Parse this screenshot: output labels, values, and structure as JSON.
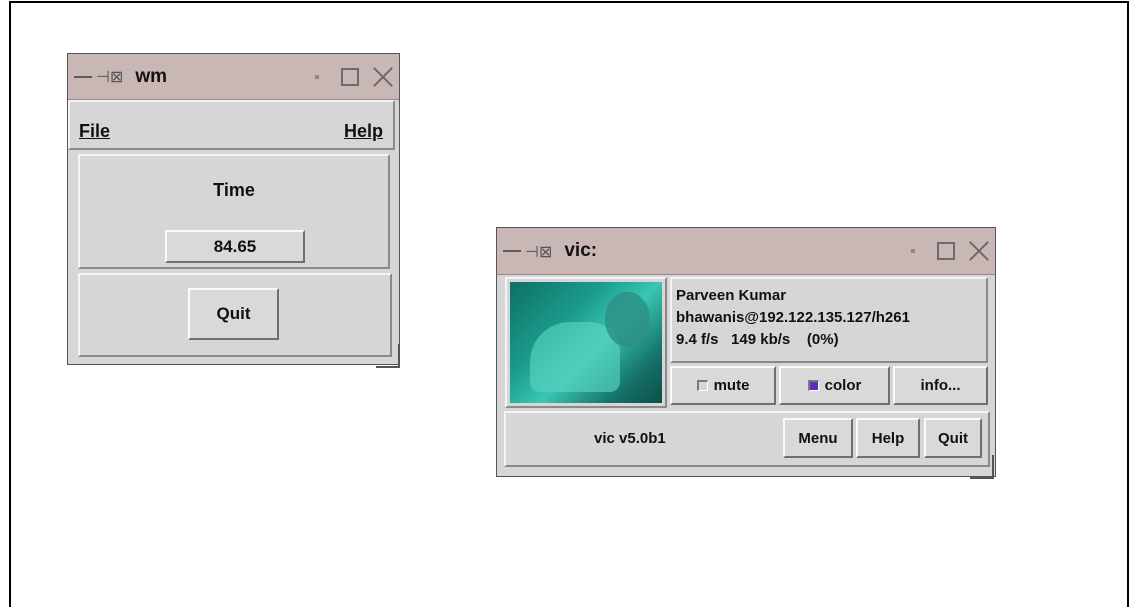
{
  "wm_window": {
    "title": "wm",
    "menu": {
      "file": "File",
      "help": "Help"
    },
    "time_label": "Time",
    "time_value": "84.65",
    "quit_label": "Quit"
  },
  "vic_window": {
    "title": "vic:",
    "source_name": "Parveen Kumar",
    "source_address": "bhawanis@192.122.135.127/h261",
    "stats": "9.4 f/s   149 kb/s    (0%)",
    "mute_label": "mute",
    "mute_checked": false,
    "color_label": "color",
    "color_checked": true,
    "info_label": "info...",
    "version": "vic v5.0b1",
    "menu_label": "Menu",
    "help_label": "Help",
    "quit_label": "Quit"
  },
  "colors": {
    "titlebar": "#c8b7b4",
    "window_bg": "#d6d6d6",
    "checkbox_on": "#5b2fb7",
    "video_tint": "#1b9c8c"
  }
}
